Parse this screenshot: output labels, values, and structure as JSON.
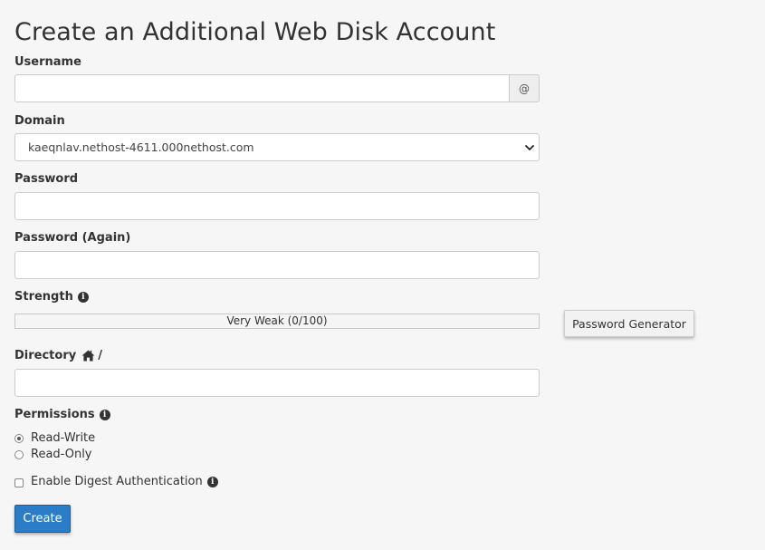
{
  "page": {
    "title": "Create an Additional Web Disk Account"
  },
  "username": {
    "label": "Username",
    "value": "",
    "addon": "@"
  },
  "domain": {
    "label": "Domain",
    "selected": "kaeqnlav.nethost-4611.000nethost.com"
  },
  "password": {
    "label": "Password",
    "value": ""
  },
  "password_again": {
    "label": "Password (Again)",
    "value": ""
  },
  "strength": {
    "label": "Strength",
    "text": "Very Weak (0/100)",
    "score": 0,
    "max": 100
  },
  "password_generator": {
    "label": "Password Generator"
  },
  "directory": {
    "label": "Directory",
    "slash": "/",
    "value": ""
  },
  "permissions": {
    "label": "Permissions",
    "options": [
      {
        "label": "Read-Write",
        "checked": true
      },
      {
        "label": "Read-Only",
        "checked": false
      }
    ]
  },
  "digest": {
    "label": "Enable Digest Authentication",
    "checked": false
  },
  "create_button": {
    "label": "Create"
  },
  "colors": {
    "primary_button": "#2b7dc7",
    "background": "#f6f6f6",
    "text": "#333333"
  },
  "icons": {
    "info": "info-circle-icon",
    "home": "home-icon",
    "chevron": "chevron-down-icon"
  }
}
